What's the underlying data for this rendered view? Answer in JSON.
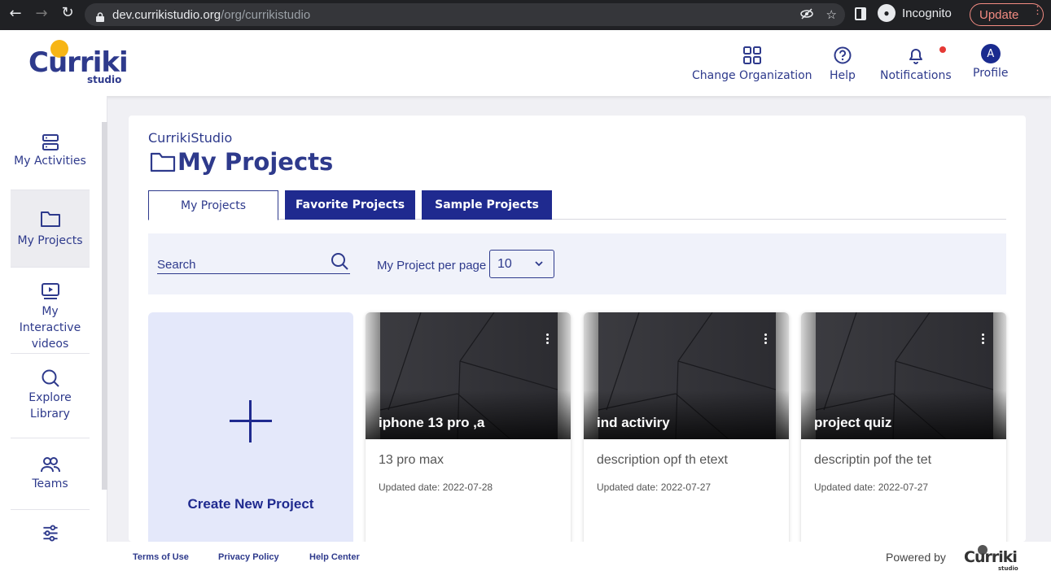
{
  "browser": {
    "url_host": "dev.currikistudio.org",
    "url_path": "/org/currikistudio",
    "profile_label": "Incognito",
    "update_label": "Update"
  },
  "header": {
    "logo_word": "Curriki",
    "logo_sub": "studio",
    "change_org": "Change Organization",
    "help": "Help",
    "notifications": "Notifications",
    "profile": "Profile",
    "profile_initial": "A",
    "colors": {
      "brand": "#2e3a8c",
      "accent": "#f7b515",
      "notif_dot": "#e53935"
    }
  },
  "sidebar": {
    "items": [
      {
        "label": "My Activities",
        "icon": "server-icon"
      },
      {
        "label": "My Projects",
        "icon": "folder-icon",
        "active": true
      },
      {
        "label": "My Interactive videos",
        "icon": "video-icon"
      },
      {
        "label": "Explore Library",
        "icon": "search-icon"
      },
      {
        "label": "Teams",
        "icon": "users-icon"
      },
      {
        "label": "",
        "icon": "sliders-icon"
      }
    ]
  },
  "main": {
    "org_name": "CurrikiStudio",
    "title": "My Projects",
    "tabs": [
      {
        "label": "My Projects",
        "active": true
      },
      {
        "label": "Favorite Projects"
      },
      {
        "label": "Sample Projects"
      }
    ],
    "search_placeholder": "Search",
    "per_page_label": "My Project per page",
    "per_page_value": "10",
    "create_label": "Create New Project",
    "projects": [
      {
        "title": "iphone 13 pro ,a",
        "description": "13 pro max",
        "updated": "Updated date: 2022-07-28"
      },
      {
        "title": "ind activiry",
        "description": "description opf th etext",
        "updated": "Updated date: 2022-07-27"
      },
      {
        "title": "project quiz",
        "description": "descriptin pof the tet",
        "updated": "Updated date: 2022-07-27"
      }
    ]
  },
  "footer": {
    "links": [
      "Terms of Use",
      "Privacy Policy",
      "Help Center"
    ],
    "powered_by": "Powered by",
    "logo_word": "Curriki",
    "logo_sub": "studio"
  }
}
